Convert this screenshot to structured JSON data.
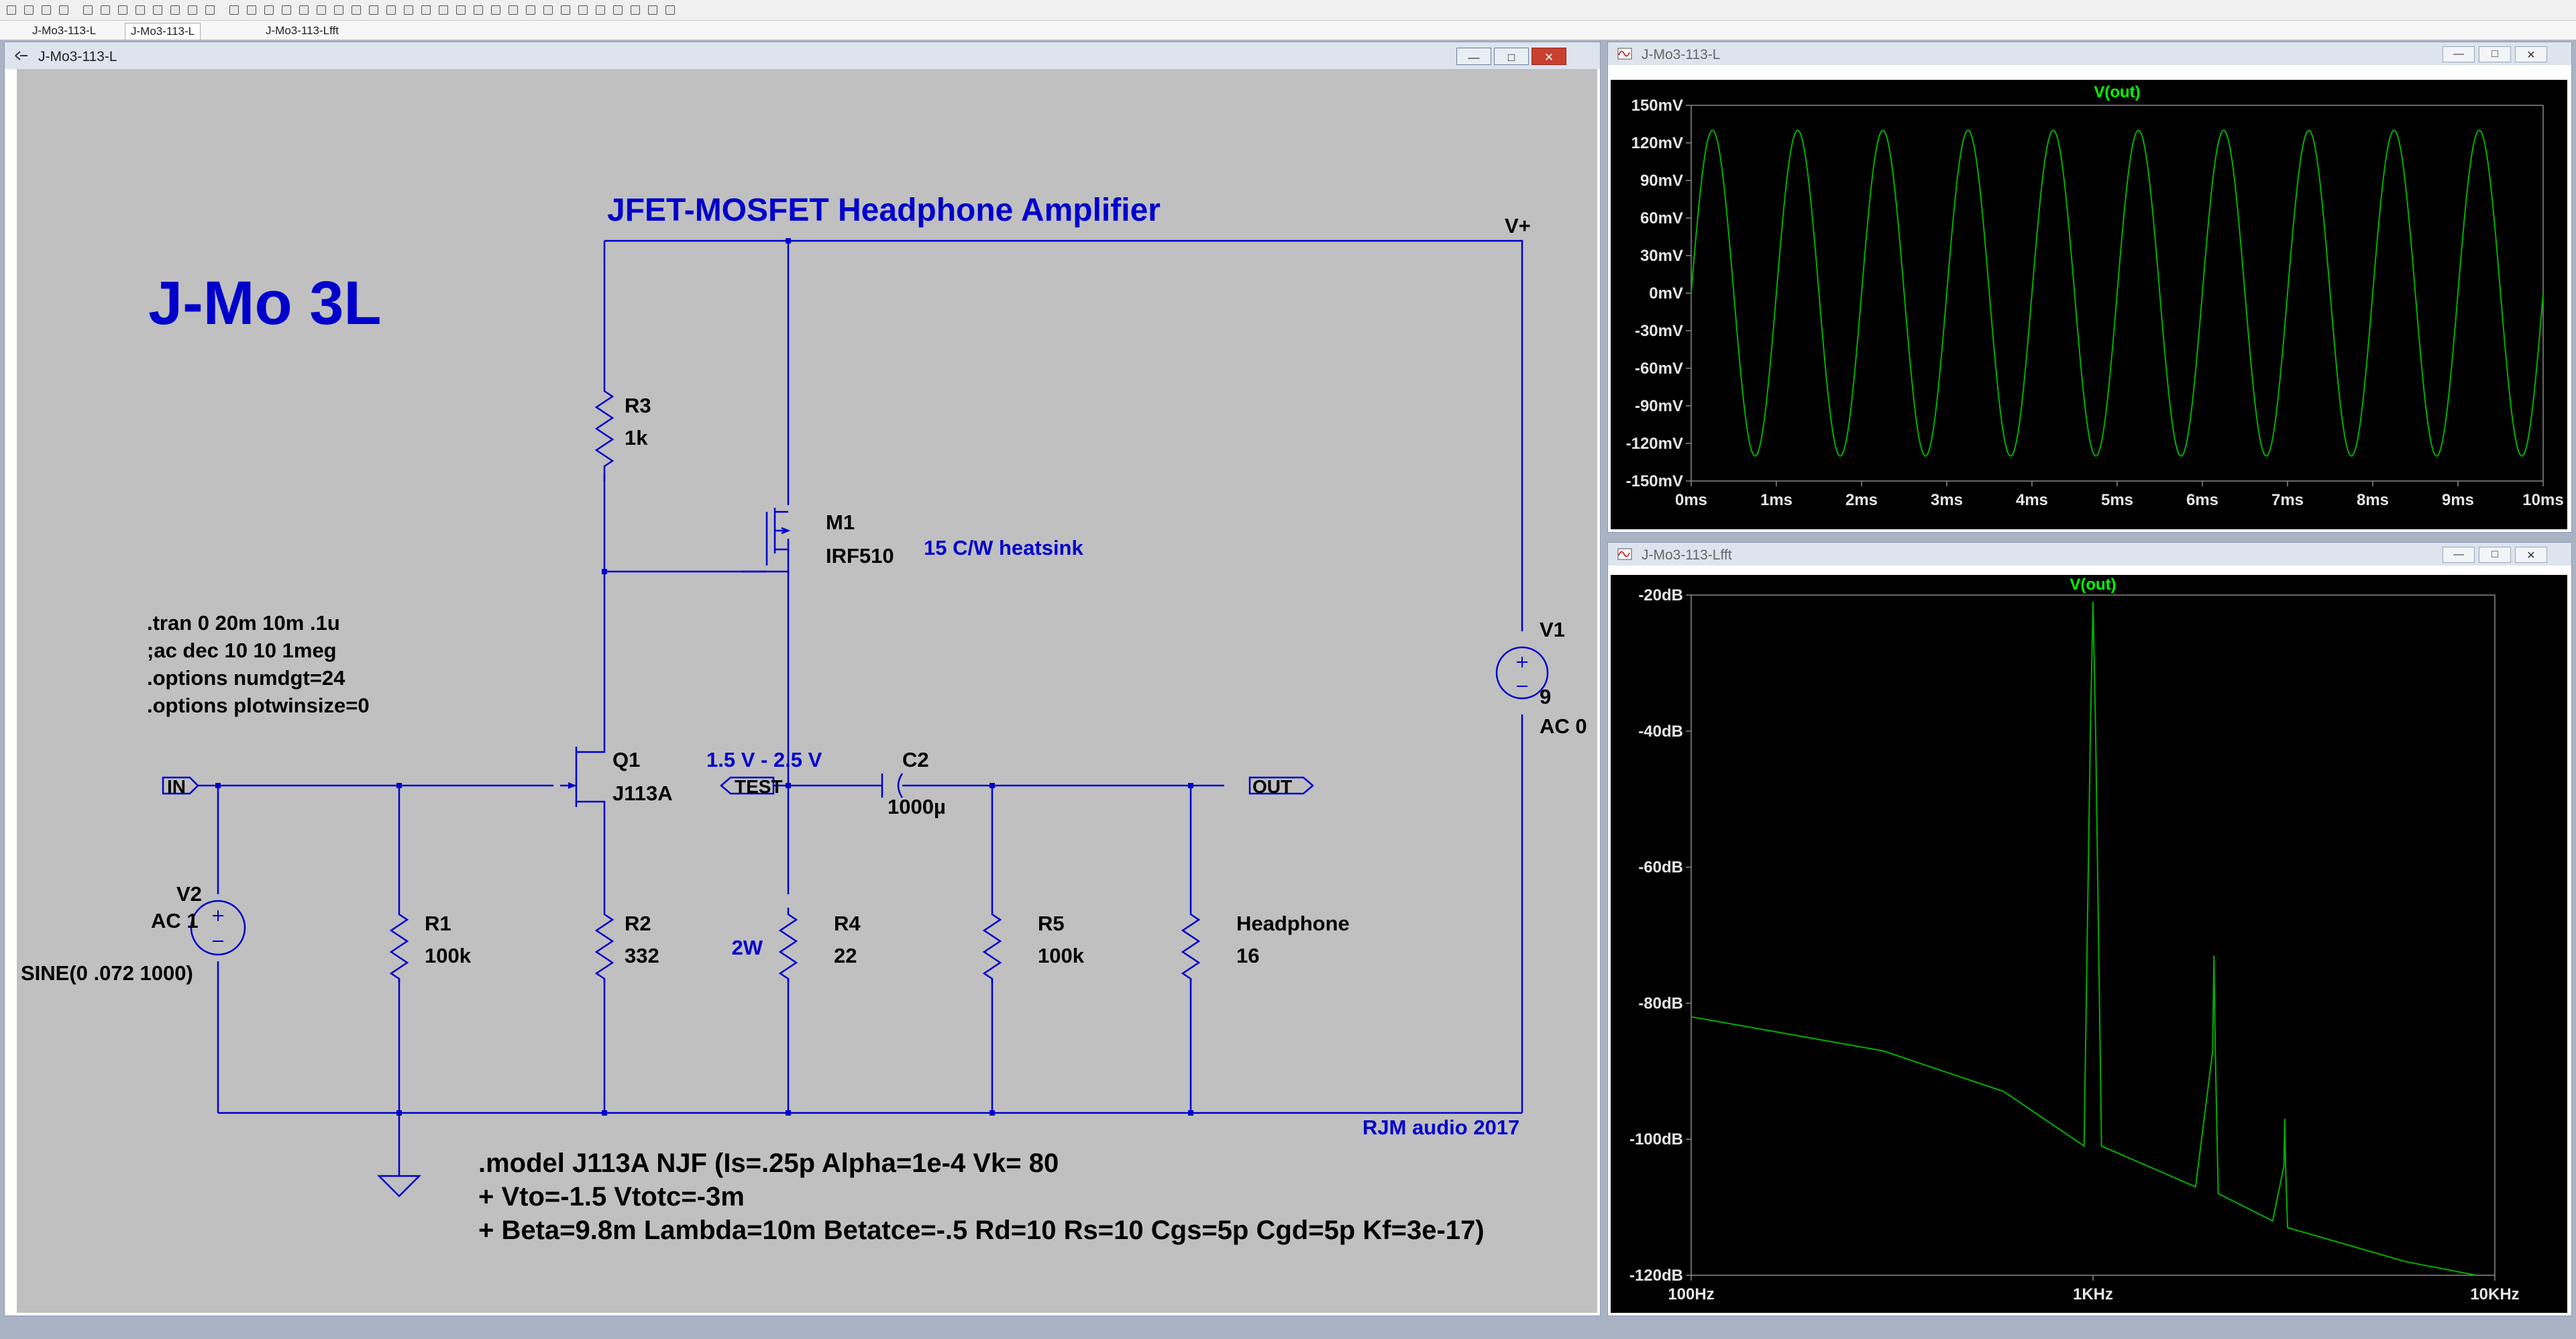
{
  "tabs": [
    {
      "label": "J-Mo3-113-L",
      "active": false
    },
    {
      "label": "J-Mo3-113-L",
      "active": true
    },
    {
      "label": "J-Mo3-113-Lfft",
      "active": false
    }
  ],
  "schematic_window": {
    "title": "J-Mo3-113-L",
    "buttons": [
      "minimize",
      "maximize",
      "close"
    ],
    "big_title": "J-Mo 3L",
    "circuit_title": "JFET-MOSFET Headphone Amplifier",
    "directives": [
      ".tran 0 20m 10m .1u",
      ";ac dec 10 10 1meg",
      ".options numdgt=24",
      ".options plotwinsize=0"
    ],
    "model_lines": [
      ".model J113A NJF (Is=.25p Alpha=1e-4 Vk= 80",
      "+ Vto=-1.5 Vtotc=-3m",
      "+ Beta=9.8m Lambda=10m Betatce=-.5 Rd=10 Rs=10 Cgs=5p Cgd=5p Kf=3e-17)"
    ],
    "labels": {
      "vplus": "V+",
      "in": "IN",
      "out": "OUT",
      "test": "TEST",
      "test_range": "1.5 V - 2.5 V",
      "heatsink": "15 C/W heatsink",
      "power": "2W",
      "credit": "RJM audio 2017"
    },
    "components": {
      "R3": {
        "name": "R3",
        "value": "1k"
      },
      "M1": {
        "name": "M1",
        "value": "IRF510"
      },
      "Q1": {
        "name": "Q1",
        "value": "J113A"
      },
      "C2": {
        "name": "C2",
        "value": "1000µ"
      },
      "V1": {
        "name": "V1",
        "value": "9",
        "extra": "AC 0"
      },
      "V2": {
        "name": "V2",
        "value": "AC 1",
        "extra": "SINE(0 .072 1000)"
      },
      "R1": {
        "name": "R1",
        "value": "100k"
      },
      "R2": {
        "name": "R2",
        "value": "332"
      },
      "R4": {
        "name": "R4",
        "value": "22"
      },
      "R5": {
        "name": "R5",
        "value": "100k"
      },
      "RL": {
        "name": "Headphone",
        "value": "16"
      }
    }
  },
  "time_window": {
    "title": "J-Mo3-113-L",
    "trace_label": "V(out)",
    "y_ticks": [
      "150mV",
      "120mV",
      "90mV",
      "60mV",
      "30mV",
      "0mV",
      "-30mV",
      "-60mV",
      "-90mV",
      "-120mV",
      "-150mV"
    ],
    "x_ticks": [
      "0ms",
      "1ms",
      "2ms",
      "3ms",
      "4ms",
      "5ms",
      "6ms",
      "7ms",
      "8ms",
      "9ms",
      "10ms"
    ]
  },
  "fft_window": {
    "title": "J-Mo3-113-Lfft",
    "trace_label": "V(out)",
    "y_ticks": [
      "-20dB",
      "-40dB",
      "-60dB",
      "-80dB",
      "-100dB",
      "-120dB"
    ],
    "x_ticks": [
      "100Hz",
      "1KHz",
      "10KHz"
    ]
  },
  "colors": {
    "schematic_bg": "#c0c0c0",
    "wire": "#0000cc",
    "text_blue": "#0000cc",
    "plot_bg": "#000000",
    "trace": "#00b000",
    "trace_label": "#00ff00"
  },
  "chart_data": [
    {
      "type": "line",
      "title": "V(out)",
      "xlabel": "",
      "ylabel": "",
      "xlim": [
        0,
        10
      ],
      "x_unit": "ms",
      "ylim": [
        -150,
        150
      ],
      "y_unit": "mV",
      "grid": false,
      "series": [
        {
          "name": "V(out)",
          "function": "sine",
          "amplitude": 130,
          "frequency_hz": 1000,
          "phase_deg": 0
        }
      ]
    },
    {
      "type": "line",
      "title": "V(out)",
      "xlabel": "",
      "ylabel": "",
      "x_scale": "log",
      "xlim": [
        100,
        10000
      ],
      "x_unit": "Hz",
      "ylim": [
        -120,
        -20
      ],
      "y_unit": "dB",
      "grid": false,
      "series": [
        {
          "name": "V(out)",
          "points": [
            [
              100,
              -82
            ],
            [
              300,
              -87
            ],
            [
              600,
              -93
            ],
            [
              950,
              -101
            ],
            [
              985,
              -40
            ],
            [
              1000,
              -21
            ],
            [
              1015,
              -40
            ],
            [
              1050,
              -101
            ],
            [
              1800,
              -107
            ],
            [
              1985,
              -87
            ],
            [
              2000,
              -73
            ],
            [
              2015,
              -87
            ],
            [
              2050,
              -108
            ],
            [
              2800,
              -112
            ],
            [
              2985,
              -104
            ],
            [
              3000,
              -97
            ],
            [
              3015,
              -104
            ],
            [
              3050,
              -113
            ],
            [
              6000,
              -118
            ],
            [
              9000,
              -120
            ]
          ]
        }
      ]
    }
  ]
}
